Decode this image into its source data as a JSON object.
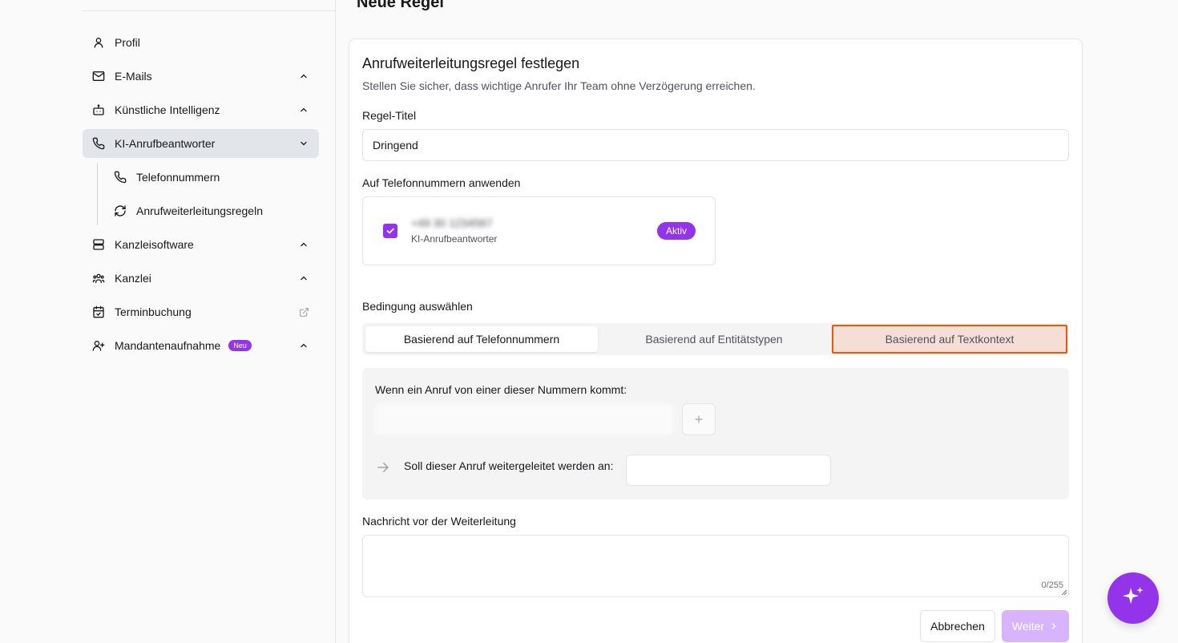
{
  "sidebar": {
    "items": [
      {
        "label": "Profil",
        "icon": "user-icon",
        "chevron": false
      },
      {
        "label": "E-Mails",
        "icon": "mail-icon",
        "chevron": "up"
      },
      {
        "label": "Künstliche Intelligenz",
        "icon": "bot-icon",
        "chevron": "up"
      },
      {
        "label": "KI-Anrufbeantworter",
        "icon": "phone-icon",
        "chevron": "down",
        "active": true
      }
    ],
    "sub_items": [
      {
        "label": "Telefonnummern",
        "icon": "phone-icon"
      },
      {
        "label": "Anrufweiterleitungsregeln",
        "icon": "refresh-icon"
      }
    ],
    "items_after": [
      {
        "label": "Kanzleisoftware",
        "icon": "server-icon",
        "chevron": "up"
      },
      {
        "label": "Kanzlei",
        "icon": "users-icon",
        "chevron": "up"
      },
      {
        "label": "Terminbuchung",
        "icon": "calendar-check-icon",
        "chevron": "external"
      },
      {
        "label": "Mandantenaufnahme",
        "icon": "user-plus-icon",
        "chevron": "up",
        "badge": "Neu"
      }
    ]
  },
  "page": {
    "heading": "Neue Regel"
  },
  "form": {
    "title": "Anrufweiterleitungsregel festlegen",
    "subtitle": "Stellen Sie sicher, dass wichtige Anrufer Ihr Team ohne Verzögerung erreichen.",
    "rule_title_label": "Regel-Titel",
    "rule_title_value": "Dringend",
    "apply_label": "Auf Telefonnummern anwenden",
    "phone": {
      "number": "+49 30 1234567",
      "type": "KI-Anrufbeantworter",
      "status": "Aktiv",
      "checked": true
    },
    "condition_label": "Bedingung auswählen",
    "tabs": [
      {
        "label": "Basierend auf Telefonnummern"
      },
      {
        "label": "Basierend auf Entitätstypen"
      },
      {
        "label": "Basierend auf Textkontext"
      }
    ],
    "condition_text": "Wenn ein Anruf von einer dieser Nummern kommt:",
    "forward_text": "Soll dieser Anruf weitergeleitet werden an:",
    "message_label": "Nachricht vor der Weiterleitung",
    "char_counter": "0/255",
    "cancel_label": "Abbrechen",
    "next_label": "Weiter"
  },
  "colors": {
    "accent": "#9333ea",
    "highlight_border": "#ea580c",
    "highlight_bg": "#f5ded6"
  }
}
